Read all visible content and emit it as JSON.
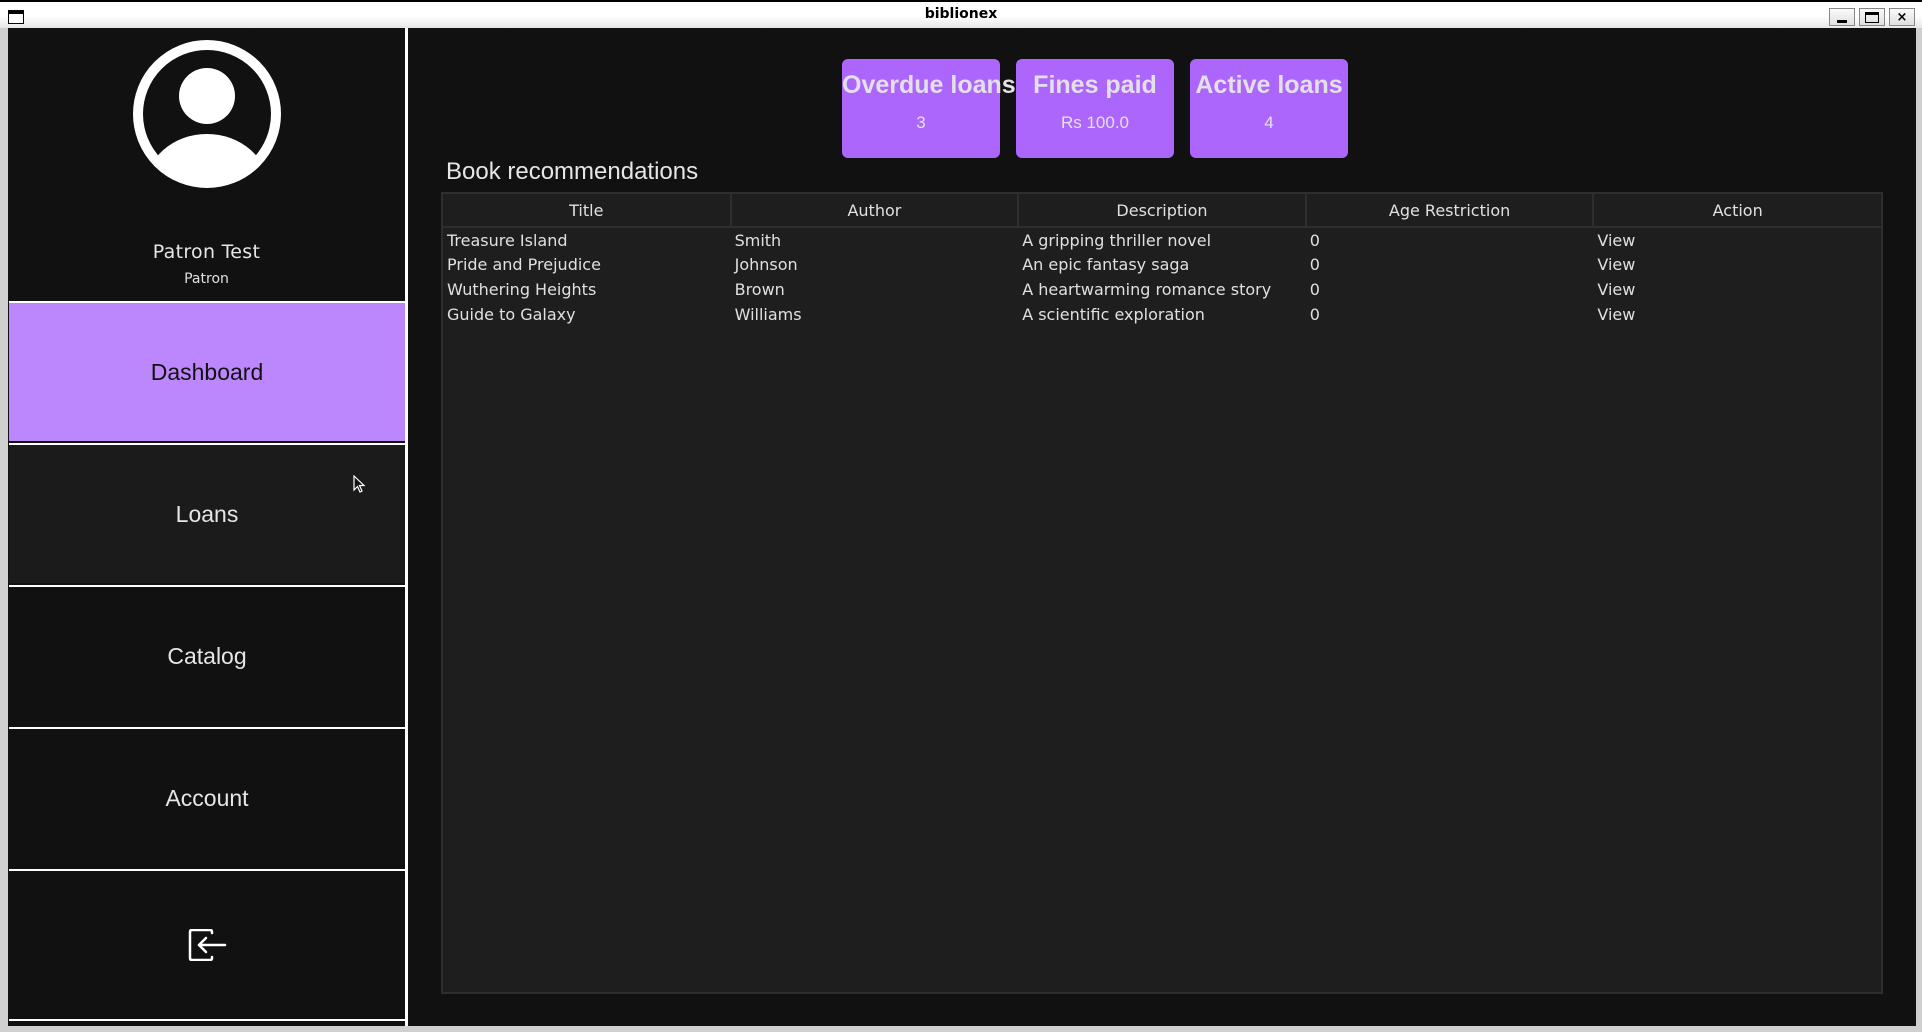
{
  "window": {
    "title": "biblionex",
    "buttons": {
      "minimize": "minimize",
      "maximize": "maximize",
      "close": "×"
    }
  },
  "profile": {
    "name": "Patron Test",
    "role": "Patron",
    "avatar_icon": "user-circle-icon"
  },
  "nav": {
    "items": [
      {
        "label": "Dashboard",
        "active": true
      },
      {
        "label": "Loans",
        "active": false
      },
      {
        "label": "Catalog",
        "active": false
      },
      {
        "label": "Account",
        "active": false
      }
    ],
    "logout_icon": "logout-icon"
  },
  "stats": [
    {
      "label": "Overdue loans",
      "value": "3"
    },
    {
      "label": "Fines paid",
      "value": "Rs 100.0"
    },
    {
      "label": "Active loans",
      "value": "4"
    }
  ],
  "recommendations": {
    "title": "Book recommendations",
    "columns": [
      "Title",
      "Author",
      "Description",
      "Age Restriction",
      "Action"
    ],
    "rows": [
      {
        "title": "Treasure Island",
        "author": "Smith",
        "description": "A gripping thriller novel",
        "age": "0",
        "action": "View"
      },
      {
        "title": "Pride and Prejudice",
        "author": "Johnson",
        "description": "An epic fantasy saga",
        "age": "0",
        "action": "View"
      },
      {
        "title": "Wuthering Heights",
        "author": "Brown",
        "description": "A heartwarming romance story",
        "age": "0",
        "action": "View"
      },
      {
        "title": "Guide to Galaxy",
        "author": "Williams",
        "description": "A scientific exploration",
        "age": "0",
        "action": "View"
      }
    ]
  },
  "colors": {
    "accent_active": "#bc87fc",
    "card_bg": "#ad66fc",
    "background": "#111111",
    "table_bg": "#1e1e1e"
  }
}
